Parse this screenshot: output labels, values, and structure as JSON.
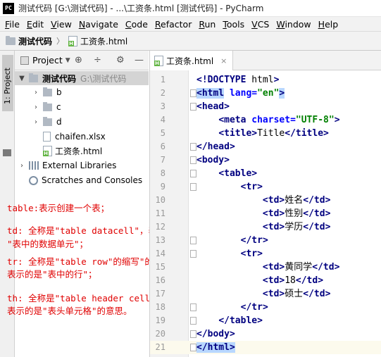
{
  "window": {
    "app_icon": "PC",
    "title": "测试代码 [G:\\测试代码] - ...\\工资条.html [测试代码] - PyCharm"
  },
  "menu": [
    {
      "label": "File",
      "key": "F",
      "rest": "ile"
    },
    {
      "label": "Edit",
      "key": "E",
      "rest": "dit"
    },
    {
      "label": "View",
      "key": "V",
      "rest": "iew"
    },
    {
      "label": "Navigate",
      "key": "N",
      "rest": "avigate"
    },
    {
      "label": "Code",
      "key": "C",
      "rest": "ode"
    },
    {
      "label": "Refactor",
      "key": "R",
      "rest": "efactor"
    },
    {
      "label": "Run",
      "key": "R",
      "rest": "un"
    },
    {
      "label": "Tools",
      "key": "T",
      "rest": "ools"
    },
    {
      "label": "VCS",
      "key": "V",
      "rest": "CS"
    },
    {
      "label": "Window",
      "key": "W",
      "rest": "indow"
    },
    {
      "label": "Help",
      "key": "H",
      "rest": "elp"
    }
  ],
  "navbar": {
    "project": "测试代码",
    "separator": "〉",
    "file": "工资条.html"
  },
  "toolstrip": {
    "label": "1: Project"
  },
  "project_panel": {
    "title": "Project",
    "caret": "▼",
    "icons": [
      "target-icon",
      "collapse-icon",
      "gear-icon",
      "hide-icon"
    ],
    "icon_glyphs": [
      "⊕",
      "÷",
      "⚙",
      "—"
    ],
    "tree": [
      {
        "name": "测试代码",
        "path": "G:\\测试代码",
        "arrow": "▼",
        "type": "dir"
      },
      {
        "name": "b",
        "arrow": "›",
        "type": "dir"
      },
      {
        "name": "c",
        "arrow": "›",
        "type": "dir"
      },
      {
        "name": "d",
        "arrow": "›",
        "type": "dir"
      },
      {
        "name": "chaifen.xlsx",
        "arrow": "",
        "type": "file"
      },
      {
        "name": "工资条.html",
        "arrow": "",
        "type": "html"
      },
      {
        "name": "External Libraries",
        "arrow": "›",
        "type": "lib"
      },
      {
        "name": "Scratches and Consoles",
        "arrow": "",
        "type": "scratch"
      }
    ]
  },
  "annotations": {
    "table": "table:表示创建一个表；",
    "td_1": "td: 全称是\"table datacell\"，表示的是",
    "td_2": "\"表中的数据单元\"；",
    "tr_1": "tr: 全称是\"table row\"的缩写\"的缩写，",
    "tr_2": "表示的是\"表中的行\"；",
    "th_1": "th: 全称是\"table header cell\"的缩写，",
    "th_2": "表示的是\"表头单元格\"的意思。"
  },
  "editor": {
    "tab_label": "工资条.html",
    "tab_close": "×",
    "current_line": 21,
    "lines": [
      {
        "n": "1",
        "text": "<!DOCTYPE html>"
      },
      {
        "n": "2",
        "text": "<html lang=\"en\">"
      },
      {
        "n": "3",
        "text": "<head>"
      },
      {
        "n": "4",
        "text": "    <meta charset=\"UTF-8\">"
      },
      {
        "n": "5",
        "text": "    <title>Title</title>"
      },
      {
        "n": "6",
        "text": "</head>"
      },
      {
        "n": "7",
        "text": "<body>"
      },
      {
        "n": "8",
        "text": "    <table>"
      },
      {
        "n": "9",
        "text": "        <tr>"
      },
      {
        "n": "10",
        "text": "            <td>姓名</td>"
      },
      {
        "n": "11",
        "text": "            <td>性别</td>"
      },
      {
        "n": "12",
        "text": "            <td>学历</td>"
      },
      {
        "n": "13",
        "text": "        </tr>"
      },
      {
        "n": "14",
        "text": "        <tr>"
      },
      {
        "n": "15",
        "text": "            <td>黄同学</td>"
      },
      {
        "n": "16",
        "text": "            <td>18</td>"
      },
      {
        "n": "17",
        "text": "            <td>硕士</td>"
      },
      {
        "n": "18",
        "text": "        </tr>"
      },
      {
        "n": "19",
        "text": "    </table>"
      },
      {
        "n": "20",
        "text": "</body>"
      },
      {
        "n": "21",
        "text": "</html>"
      }
    ]
  }
}
